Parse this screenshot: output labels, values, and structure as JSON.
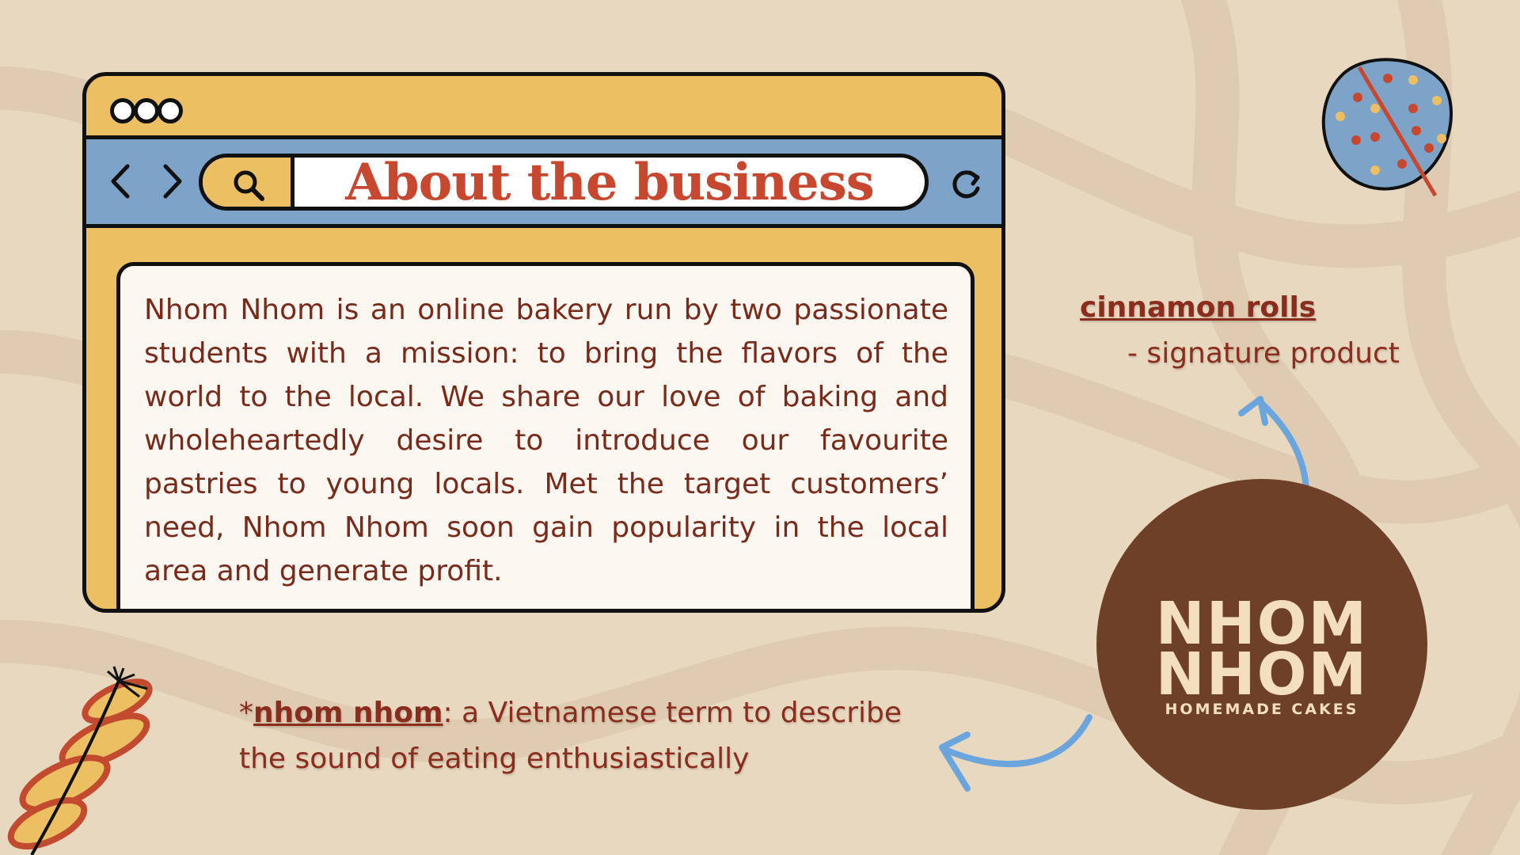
{
  "window": {
    "url_title": "About the business",
    "body": "Nhom Nhom is an online bakery run by two passionate students with a mission: to bring the flavors of the world to the local. We share our love of baking and wholeheartedly desire to introduce our favourite pastries to young locals. Met the target customers’ need, Nhom Nhom soon gain popularity in the local area and generate profit."
  },
  "note": {
    "title": "cinnamon rolls",
    "subtitle": "- signature product"
  },
  "footnote": {
    "prefix": "*",
    "term": "nhom nhom",
    "definition": ": a Vietnamese term to describe the sound of eating enthusiastically"
  },
  "logo": {
    "line1": "NHOM",
    "line2": "NHOM",
    "tagline": "HOMEMADE CAKES"
  },
  "colors": {
    "background": "#e9d8c0",
    "window_yellow": "#ecbf62",
    "nav_blue": "#7ea3c9",
    "title_red": "#c8472f",
    "text_brown": "#7a2a1a",
    "logo_brown": "#6e4027",
    "arrow_blue": "#6aa6dd"
  },
  "icons": [
    "search-icon",
    "back-arrow-icon",
    "forward-arrow-icon",
    "reload-icon"
  ]
}
